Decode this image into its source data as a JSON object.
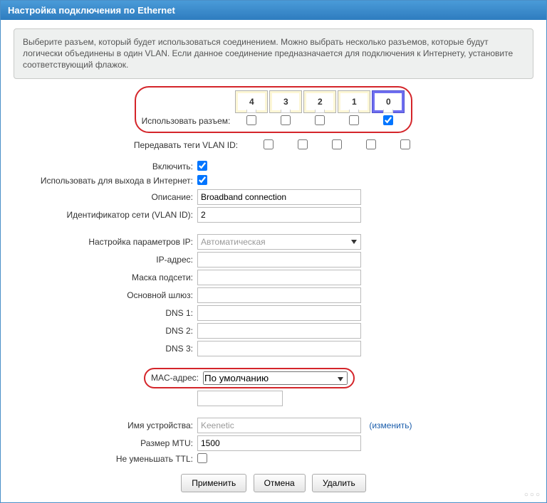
{
  "title": "Настройка подключения по Ethernet",
  "info": "Выберите разъем, который будет использоваться соединением. Можно выбрать несколько разъемов, которые будут логически объединены в один VLAN. Если данное соединение предназначается для подключения к Интернету, установите соответствующий флажок.",
  "ports": {
    "labels": [
      "4",
      "3",
      "2",
      "1",
      "0"
    ],
    "use_label": "Использовать разъем:",
    "vlan_label": "Передавать теги VLAN ID:"
  },
  "fields": {
    "enable": "Включить:",
    "internet": "Использовать для выхода в Интернет:",
    "desc_label": "Описание:",
    "desc_value": "Broadband connection",
    "vlanid_label": "Идентификатор сети (VLAN ID):",
    "vlanid_value": "2",
    "ipmode_label": "Настройка параметров IP:",
    "ipmode_value": "Автоматическая",
    "ip_label": "IP-адрес:",
    "mask_label": "Маска подсети:",
    "gw_label": "Основной шлюз:",
    "dns1_label": "DNS 1:",
    "dns2_label": "DNS 2:",
    "dns3_label": "DNS 3:",
    "mac_label": "MAC-адрес:",
    "mac_value": "По умолчанию",
    "devname_label": "Имя устройства:",
    "devname_value": "Keenetic",
    "change_link": "(изменить)",
    "mtu_label": "Размер MTU:",
    "mtu_value": "1500",
    "ttl_label": "Не уменьшать TTL:"
  },
  "buttons": {
    "apply": "Применить",
    "cancel": "Отмена",
    "delete": "Удалить"
  }
}
